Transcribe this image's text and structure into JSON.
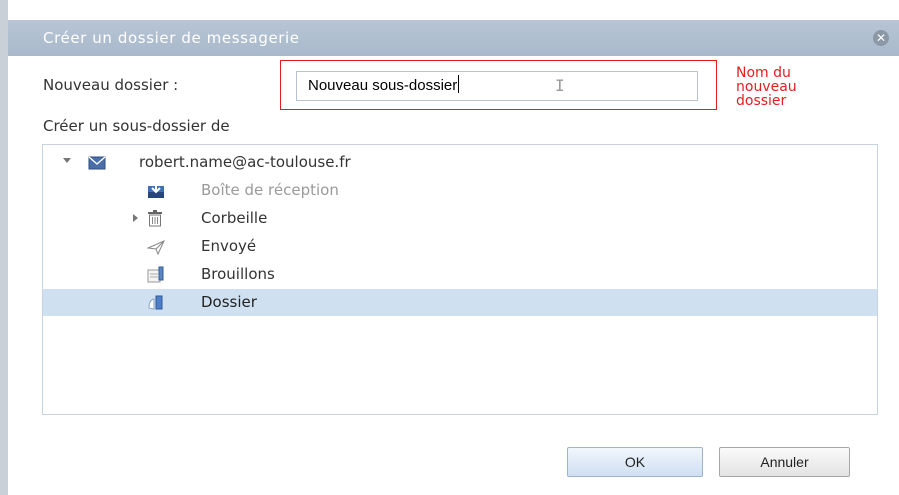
{
  "dialog": {
    "title": "Créer un dossier de messagerie",
    "close_icon": "close-icon"
  },
  "form": {
    "new_folder_label": "Nouveau dossier :",
    "new_folder_value": "Nouveau sous-dossier",
    "annotation_line1": "Nom du",
    "annotation_line2": "nouveau",
    "annotation_line3": "dossier",
    "parent_label": "Créer un sous-dossier de"
  },
  "tree": {
    "account": "robert.name@ac-toulouse.fr",
    "folders": [
      {
        "label": "Boîte de réception",
        "icon": "inbox-icon",
        "disabled": true
      },
      {
        "label": "Corbeille",
        "icon": "trash-icon",
        "expandable": true
      },
      {
        "label": "Envoyé",
        "icon": "sent-icon"
      },
      {
        "label": "Brouillons",
        "icon": "drafts-icon"
      },
      {
        "label": "Dossier",
        "icon": "folder-icon",
        "selected": true
      }
    ]
  },
  "buttons": {
    "ok": "OK",
    "cancel": "Annuler"
  },
  "colors": {
    "title_bar": "#b0c0d2",
    "annotation": "#e02020",
    "selection": "#cfe0f1"
  }
}
